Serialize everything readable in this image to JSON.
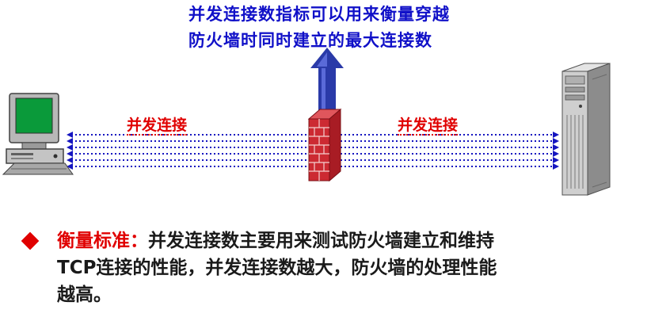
{
  "heading": {
    "line1": "并发连接数指标可以用来衡量穿越",
    "line2": "防火墙时同时建立的最大连接数"
  },
  "diagram": {
    "left_label": "并发连接",
    "right_label": "并发连接",
    "icons": [
      "pc-icon",
      "firewall-icon",
      "server-icon"
    ],
    "colors": {
      "heading": "#1010c8",
      "connection_label": "#e00000",
      "connection_lines": "#1515c0",
      "firewall": "#c8202a",
      "arrow": "#2a3aa8"
    }
  },
  "bullet": {
    "criterion": "衡量标准：",
    "line1": "并发连接数主要用来测试防火墙建立和维持",
    "line2": "TCP连接的性能，并发连接数越大，防火墙的处理性能",
    "line3": "越高。",
    "marker_color": "#e00000"
  }
}
